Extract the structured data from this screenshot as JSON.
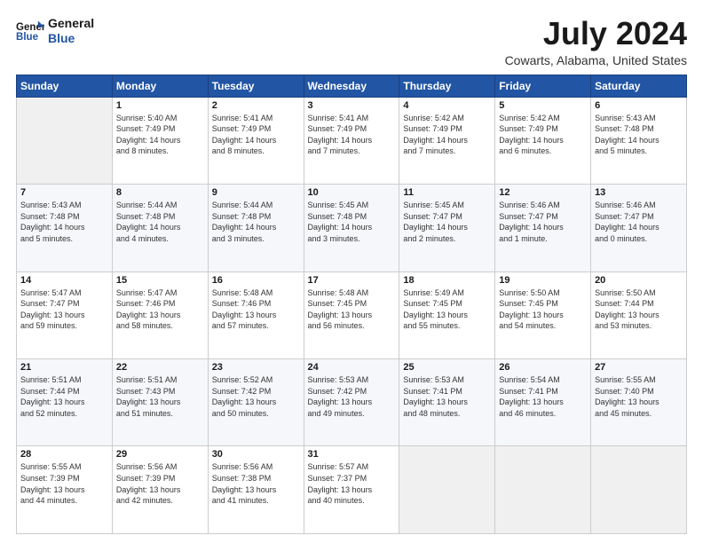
{
  "logo": {
    "line1": "General",
    "line2": "Blue"
  },
  "title": "July 2024",
  "subtitle": "Cowarts, Alabama, United States",
  "days_of_week": [
    "Sunday",
    "Monday",
    "Tuesday",
    "Wednesday",
    "Thursday",
    "Friday",
    "Saturday"
  ],
  "weeks": [
    [
      {
        "num": "",
        "info": ""
      },
      {
        "num": "1",
        "info": "Sunrise: 5:40 AM\nSunset: 7:49 PM\nDaylight: 14 hours\nand 8 minutes."
      },
      {
        "num": "2",
        "info": "Sunrise: 5:41 AM\nSunset: 7:49 PM\nDaylight: 14 hours\nand 8 minutes."
      },
      {
        "num": "3",
        "info": "Sunrise: 5:41 AM\nSunset: 7:49 PM\nDaylight: 14 hours\nand 7 minutes."
      },
      {
        "num": "4",
        "info": "Sunrise: 5:42 AM\nSunset: 7:49 PM\nDaylight: 14 hours\nand 7 minutes."
      },
      {
        "num": "5",
        "info": "Sunrise: 5:42 AM\nSunset: 7:49 PM\nDaylight: 14 hours\nand 6 minutes."
      },
      {
        "num": "6",
        "info": "Sunrise: 5:43 AM\nSunset: 7:48 PM\nDaylight: 14 hours\nand 5 minutes."
      }
    ],
    [
      {
        "num": "7",
        "info": "Sunrise: 5:43 AM\nSunset: 7:48 PM\nDaylight: 14 hours\nand 5 minutes."
      },
      {
        "num": "8",
        "info": "Sunrise: 5:44 AM\nSunset: 7:48 PM\nDaylight: 14 hours\nand 4 minutes."
      },
      {
        "num": "9",
        "info": "Sunrise: 5:44 AM\nSunset: 7:48 PM\nDaylight: 14 hours\nand 3 minutes."
      },
      {
        "num": "10",
        "info": "Sunrise: 5:45 AM\nSunset: 7:48 PM\nDaylight: 14 hours\nand 3 minutes."
      },
      {
        "num": "11",
        "info": "Sunrise: 5:45 AM\nSunset: 7:47 PM\nDaylight: 14 hours\nand 2 minutes."
      },
      {
        "num": "12",
        "info": "Sunrise: 5:46 AM\nSunset: 7:47 PM\nDaylight: 14 hours\nand 1 minute."
      },
      {
        "num": "13",
        "info": "Sunrise: 5:46 AM\nSunset: 7:47 PM\nDaylight: 14 hours\nand 0 minutes."
      }
    ],
    [
      {
        "num": "14",
        "info": "Sunrise: 5:47 AM\nSunset: 7:47 PM\nDaylight: 13 hours\nand 59 minutes."
      },
      {
        "num": "15",
        "info": "Sunrise: 5:47 AM\nSunset: 7:46 PM\nDaylight: 13 hours\nand 58 minutes."
      },
      {
        "num": "16",
        "info": "Sunrise: 5:48 AM\nSunset: 7:46 PM\nDaylight: 13 hours\nand 57 minutes."
      },
      {
        "num": "17",
        "info": "Sunrise: 5:48 AM\nSunset: 7:45 PM\nDaylight: 13 hours\nand 56 minutes."
      },
      {
        "num": "18",
        "info": "Sunrise: 5:49 AM\nSunset: 7:45 PM\nDaylight: 13 hours\nand 55 minutes."
      },
      {
        "num": "19",
        "info": "Sunrise: 5:50 AM\nSunset: 7:45 PM\nDaylight: 13 hours\nand 54 minutes."
      },
      {
        "num": "20",
        "info": "Sunrise: 5:50 AM\nSunset: 7:44 PM\nDaylight: 13 hours\nand 53 minutes."
      }
    ],
    [
      {
        "num": "21",
        "info": "Sunrise: 5:51 AM\nSunset: 7:44 PM\nDaylight: 13 hours\nand 52 minutes."
      },
      {
        "num": "22",
        "info": "Sunrise: 5:51 AM\nSunset: 7:43 PM\nDaylight: 13 hours\nand 51 minutes."
      },
      {
        "num": "23",
        "info": "Sunrise: 5:52 AM\nSunset: 7:42 PM\nDaylight: 13 hours\nand 50 minutes."
      },
      {
        "num": "24",
        "info": "Sunrise: 5:53 AM\nSunset: 7:42 PM\nDaylight: 13 hours\nand 49 minutes."
      },
      {
        "num": "25",
        "info": "Sunrise: 5:53 AM\nSunset: 7:41 PM\nDaylight: 13 hours\nand 48 minutes."
      },
      {
        "num": "26",
        "info": "Sunrise: 5:54 AM\nSunset: 7:41 PM\nDaylight: 13 hours\nand 46 minutes."
      },
      {
        "num": "27",
        "info": "Sunrise: 5:55 AM\nSunset: 7:40 PM\nDaylight: 13 hours\nand 45 minutes."
      }
    ],
    [
      {
        "num": "28",
        "info": "Sunrise: 5:55 AM\nSunset: 7:39 PM\nDaylight: 13 hours\nand 44 minutes."
      },
      {
        "num": "29",
        "info": "Sunrise: 5:56 AM\nSunset: 7:39 PM\nDaylight: 13 hours\nand 42 minutes."
      },
      {
        "num": "30",
        "info": "Sunrise: 5:56 AM\nSunset: 7:38 PM\nDaylight: 13 hours\nand 41 minutes."
      },
      {
        "num": "31",
        "info": "Sunrise: 5:57 AM\nSunset: 7:37 PM\nDaylight: 13 hours\nand 40 minutes."
      },
      {
        "num": "",
        "info": ""
      },
      {
        "num": "",
        "info": ""
      },
      {
        "num": "",
        "info": ""
      }
    ]
  ]
}
